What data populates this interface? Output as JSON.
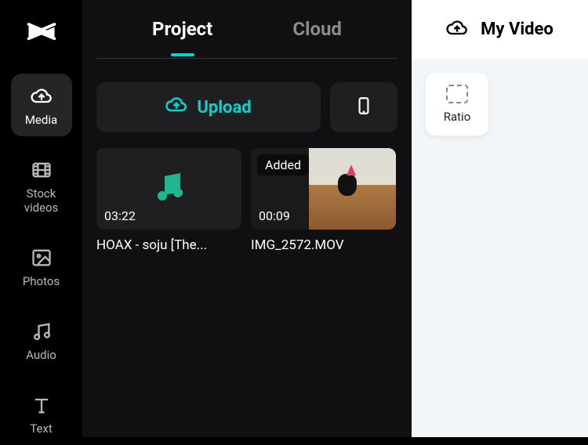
{
  "sidebar": {
    "items": [
      {
        "label": "Media"
      },
      {
        "label": "Stock videos"
      },
      {
        "label": "Photos"
      },
      {
        "label": "Audio"
      },
      {
        "label": "Text"
      }
    ]
  },
  "tabs": {
    "project": "Project",
    "cloud": "Cloud"
  },
  "actions": {
    "upload_label": "Upload"
  },
  "media": [
    {
      "duration": "03:22",
      "title": "HOAX - soju [The...",
      "badge": null,
      "kind": "audio"
    },
    {
      "duration": "00:09",
      "title": "IMG_2572.MOV",
      "badge": "Added",
      "kind": "video"
    }
  ],
  "right": {
    "title": "My Video",
    "ratio_label": "Ratio"
  },
  "colors": {
    "accent": "#00d6d0"
  }
}
